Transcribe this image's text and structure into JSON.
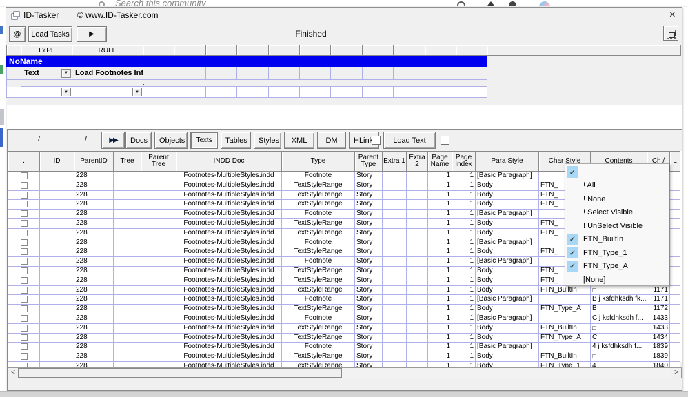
{
  "browser_strip": {
    "search_placeholder": "Search this community"
  },
  "window": {
    "title": "ID-Tasker",
    "subtitle": "© www.ID-Tasker.com",
    "close_glyph": "×"
  },
  "toolbar": {
    "at_button": "@",
    "load_tasks_label": "Load Tasks",
    "play_glyph": "▶",
    "status": "Finished"
  },
  "rule_grid": {
    "col_type_label": "TYPE",
    "col_rule_label": "RULE",
    "group_name": "NoName",
    "rule_row": {
      "type_value": "Text",
      "rule_value": "Load Footnotes Info"
    },
    "note_dot": ".",
    "combo_glyph": "▼"
  },
  "tab_bar": {
    "path_left": "/",
    "path_right": "/",
    "forward_glyph": "▶▶",
    "tabs": [
      "Docs",
      "Objects",
      "Texts",
      "Tables",
      "Styles",
      "XML",
      "DM",
      "HLinks"
    ],
    "active_tab": "Texts",
    "load_text_label": "Load Text"
  },
  "table": {
    "columns": [
      ".",
      "ID",
      "ParentID",
      "Tree",
      "Parent Tree",
      "INDD Doc",
      "Type",
      "Parent Type",
      "Extra 1",
      "Extra 2",
      "Page Name",
      "Page Index",
      "Para Style",
      "Char Style",
      "Contents",
      "Ch /",
      "L"
    ],
    "rows": [
      {
        "parent_id": "228",
        "doc": "Footnotes-MultipleStyles.indd",
        "type": "Footnote",
        "parent_type": "Story",
        "page_name": "1",
        "page_index": "1",
        "para_style": "[Basic Paragraph]",
        "char_style": "",
        "contents": "",
        "ch": ""
      },
      {
        "parent_id": "228",
        "doc": "Footnotes-MultipleStyles.indd",
        "type": "TextStyleRange",
        "parent_type": "Story",
        "page_name": "1",
        "page_index": "1",
        "para_style": "Body",
        "char_style": "FTN_",
        "contents": "",
        "ch": ""
      },
      {
        "parent_id": "228",
        "doc": "Footnotes-MultipleStyles.indd",
        "type": "TextStyleRange",
        "parent_type": "Story",
        "page_name": "1",
        "page_index": "1",
        "para_style": "Body",
        "char_style": "FTN_",
        "contents": "",
        "ch": ""
      },
      {
        "parent_id": "228",
        "doc": "Footnotes-MultipleStyles.indd",
        "type": "TextStyleRange",
        "parent_type": "Story",
        "page_name": "1",
        "page_index": "1",
        "para_style": "Body",
        "char_style": "FTN_",
        "contents": "",
        "ch": ""
      },
      {
        "parent_id": "228",
        "doc": "Footnotes-MultipleStyles.indd",
        "type": "Footnote",
        "parent_type": "Story",
        "page_name": "1",
        "page_index": "1",
        "para_style": "[Basic Paragraph]",
        "char_style": "",
        "contents": "",
        "ch": ""
      },
      {
        "parent_id": "228",
        "doc": "Footnotes-MultipleStyles.indd",
        "type": "TextStyleRange",
        "parent_type": "Story",
        "page_name": "1",
        "page_index": "1",
        "para_style": "Body",
        "char_style": "FTN_",
        "contents": "",
        "ch": ""
      },
      {
        "parent_id": "228",
        "doc": "Footnotes-MultipleStyles.indd",
        "type": "TextStyleRange",
        "parent_type": "Story",
        "page_name": "1",
        "page_index": "1",
        "para_style": "Body",
        "char_style": "FTN_",
        "contents": "",
        "ch": ""
      },
      {
        "parent_id": "228",
        "doc": "Footnotes-MultipleStyles.indd",
        "type": "Footnote",
        "parent_type": "Story",
        "page_name": "1",
        "page_index": "1",
        "para_style": "[Basic Paragraph]",
        "char_style": "",
        "contents": "",
        "ch": ""
      },
      {
        "parent_id": "228",
        "doc": "Footnotes-MultipleStyles.indd",
        "type": "TextStyleRange",
        "parent_type": "Story",
        "page_name": "1",
        "page_index": "1",
        "para_style": "Body",
        "char_style": "FTN_",
        "contents": "",
        "ch": ""
      },
      {
        "parent_id": "228",
        "doc": "Footnotes-MultipleStyles.indd",
        "type": "Footnote",
        "parent_type": "Story",
        "page_name": "1",
        "page_index": "1",
        "para_style": "[Basic Paragraph]",
        "char_style": "",
        "contents": "",
        "ch": ""
      },
      {
        "parent_id": "228",
        "doc": "Footnotes-MultipleStyles.indd",
        "type": "TextStyleRange",
        "parent_type": "Story",
        "page_name": "1",
        "page_index": "1",
        "para_style": "Body",
        "char_style": "FTN_",
        "contents": "",
        "ch": ""
      },
      {
        "parent_id": "228",
        "doc": "Footnotes-MultipleStyles.indd",
        "type": "TextStyleRange",
        "parent_type": "Story",
        "page_name": "1",
        "page_index": "1",
        "para_style": "Body",
        "char_style": "FTN_",
        "contents": "",
        "ch": ""
      },
      {
        "parent_id": "228",
        "doc": "Footnotes-MultipleStyles.indd",
        "type": "TextStyleRange",
        "parent_type": "Story",
        "page_name": "1",
        "page_index": "1",
        "para_style": "Body",
        "char_style": "FTN_BuiltIn",
        "contents": "□",
        "ch": "1171"
      },
      {
        "parent_id": "228",
        "doc": "Footnotes-MultipleStyles.indd",
        "type": "Footnote",
        "parent_type": "Story",
        "page_name": "1",
        "page_index": "1",
        "para_style": "[Basic Paragraph]",
        "char_style": "",
        "contents": "B j ksfdhksdh fk...",
        "ch": "1171"
      },
      {
        "parent_id": "228",
        "doc": "Footnotes-MultipleStyles.indd",
        "type": "TextStyleRange",
        "parent_type": "Story",
        "page_name": "1",
        "page_index": "1",
        "para_style": "Body",
        "char_style": "FTN_Type_A",
        "contents": "B",
        "ch": "1172"
      },
      {
        "parent_id": "228",
        "doc": "Footnotes-MultipleStyles.indd",
        "type": "Footnote",
        "parent_type": "Story",
        "page_name": "1",
        "page_index": "1",
        "para_style": "[Basic Paragraph]",
        "char_style": "",
        "contents": "C j ksfdhksdh f...",
        "ch": "1433"
      },
      {
        "parent_id": "228",
        "doc": "Footnotes-MultipleStyles.indd",
        "type": "TextStyleRange",
        "parent_type": "Story",
        "page_name": "1",
        "page_index": "1",
        "para_style": "Body",
        "char_style": "FTN_BuiltIn",
        "contents": "□",
        "ch": "1433"
      },
      {
        "parent_id": "228",
        "doc": "Footnotes-MultipleStyles.indd",
        "type": "TextStyleRange",
        "parent_type": "Story",
        "page_name": "1",
        "page_index": "1",
        "para_style": "Body",
        "char_style": "FTN_Type_A",
        "contents": "C",
        "ch": "1434"
      },
      {
        "parent_id": "228",
        "doc": "Footnotes-MultipleStyles.indd",
        "type": "Footnote",
        "parent_type": "Story",
        "page_name": "1",
        "page_index": "1",
        "para_style": "[Basic Paragraph]",
        "char_style": "",
        "contents": "4 j ksfdhksdh f...",
        "ch": "1839"
      },
      {
        "parent_id": "228",
        "doc": "Footnotes-MultipleStyles.indd",
        "type": "TextStyleRange",
        "parent_type": "Story",
        "page_name": "1",
        "page_index": "1",
        "para_style": "Body",
        "char_style": "FTN_BuiltIn",
        "contents": "□",
        "ch": "1839"
      },
      {
        "parent_id": "228",
        "doc": "Footnotes-MultipleStyles.indd",
        "type": "TextStyleRange",
        "parent_type": "Story",
        "page_name": "1",
        "page_index": "1",
        "para_style": "Body",
        "char_style": "FTN_Type_1",
        "contents": "4",
        "ch": "1840"
      }
    ]
  },
  "dropdown": {
    "check_glyph": "✓",
    "items": [
      {
        "label": "",
        "checked": true
      },
      {
        "label": "! All",
        "checked": false
      },
      {
        "label": "! None",
        "checked": false
      },
      {
        "label": "! Select Visible",
        "checked": false
      },
      {
        "label": "! UnSelect Visible",
        "checked": false
      },
      {
        "label": "FTN_BuiltIn",
        "checked": true
      },
      {
        "label": "FTN_Type_1",
        "checked": true
      },
      {
        "label": "FTN_Type_A",
        "checked": true
      },
      {
        "label": "[None]",
        "checked": false
      }
    ]
  },
  "scrollbar": {
    "left_glyph": "<",
    "right_glyph": ">"
  },
  "colors": {
    "noname_blue": "#0000f0",
    "grid_line": "#b0b0e8",
    "check_blue": "#a8d8f6"
  }
}
